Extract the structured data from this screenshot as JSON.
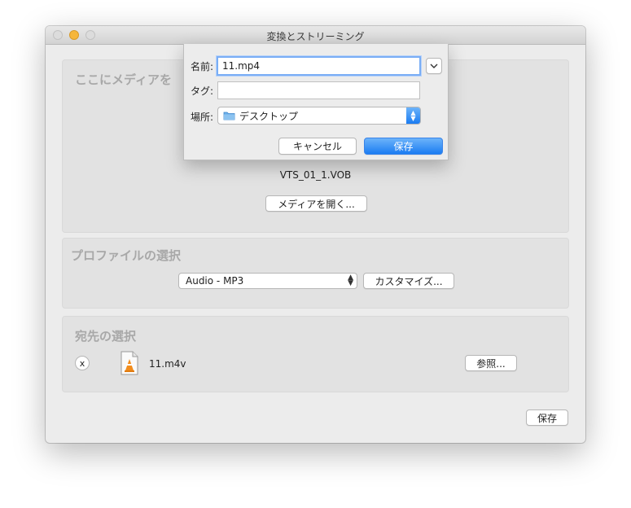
{
  "window": {
    "title": "変換とストリーミング"
  },
  "source": {
    "heading": "ここにメディアを",
    "filename": "VTS_01_1.VOB",
    "open_button": "メディアを開く..."
  },
  "profile": {
    "heading": "プロファイルの選択",
    "selected": "Audio - MP3",
    "customize_button": "カスタマイズ..."
  },
  "destination": {
    "heading": "宛先の選択",
    "remove_label": "x",
    "file": "11.m4v",
    "browse_button": "参照..."
  },
  "footer": {
    "save_button": "保存"
  },
  "save_dialog": {
    "name_label": "名前:",
    "name_value": "11.mp4",
    "tags_label": "タグ:",
    "tags_value": "",
    "location_label": "場所:",
    "location_value": "デスクトップ",
    "cancel_button": "キャンセル",
    "save_button": "保存"
  },
  "colors": {
    "accent": "#1b7cf2",
    "minimize_light": "#f6b63a"
  },
  "icons": [
    "chevron-down-icon",
    "folder-icon",
    "updown-arrows-icon",
    "vlc-file-icon"
  ]
}
